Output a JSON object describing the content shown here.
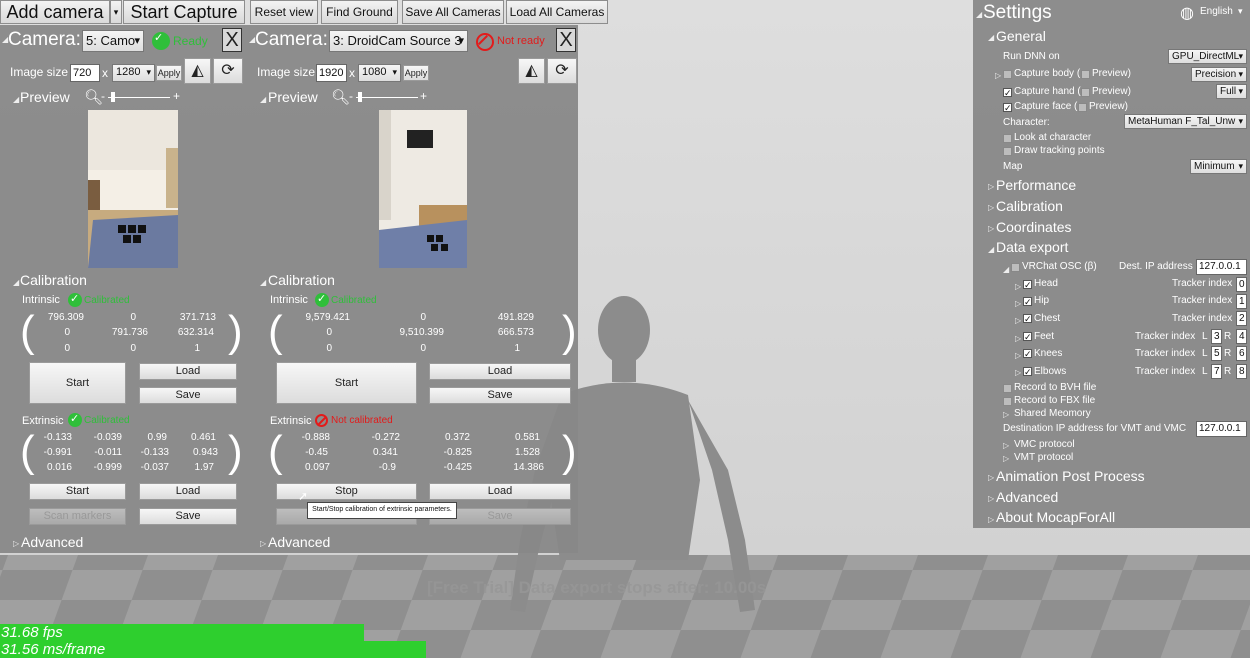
{
  "toolbar": {
    "add_camera": "Add camera",
    "start_capture": "Start Capture",
    "reset_view": "Reset view",
    "find_ground": "Find Ground",
    "save_all": "Save All Cameras",
    "load_all": "Load All Cameras"
  },
  "cameras": [
    {
      "label": "Camera:",
      "source": "5: Camo",
      "status": "Ready",
      "close": "X",
      "image_size_label": "Image size",
      "width": "720",
      "x": "x",
      "height": "1280",
      "apply": "Apply",
      "preview_label": "Preview",
      "calibration_label": "Calibration",
      "intrinsic_label": "Intrinsic",
      "intrinsic_status": "Calibrated",
      "intrinsic": [
        [
          "796.309",
          "0",
          "371.713"
        ],
        [
          "0",
          "791.736",
          "632.314"
        ],
        [
          "0",
          "0",
          "1"
        ]
      ],
      "start": "Start",
      "load": "Load",
      "save": "Save",
      "extrinsic_label": "Extrinsic",
      "extrinsic_status": "Calibrated",
      "extrinsic": [
        [
          "-0.133",
          "-0.039",
          "0.99",
          "0.461"
        ],
        [
          "-0.991",
          "-0.011",
          "-0.133",
          "0.943"
        ],
        [
          "0.016",
          "-0.999",
          "-0.037",
          "1.97"
        ]
      ],
      "ext_start": "Start",
      "ext_load": "Load",
      "scan_markers": "Scan markers",
      "ext_save": "Save",
      "advanced": "Advanced"
    },
    {
      "label": "Camera:",
      "source": "3: DroidCam Source 3",
      "status": "Not ready",
      "close": "X",
      "image_size_label": "Image size",
      "width": "1920",
      "x": "x",
      "height": "1080",
      "apply": "Apply",
      "preview_label": "Preview",
      "calibration_label": "Calibration",
      "intrinsic_label": "Intrinsic",
      "intrinsic_status": "Calibrated",
      "intrinsic": [
        [
          "9,579.421",
          "0",
          "491.829"
        ],
        [
          "0",
          "9,510.399",
          "666.573"
        ],
        [
          "0",
          "0",
          "1"
        ]
      ],
      "start": "Start",
      "load": "Load",
      "save": "Save",
      "extrinsic_label": "Extrinsic",
      "extrinsic_status": "Not calibrated",
      "extrinsic": [
        [
          "-0.888",
          "-0.272",
          "0.372",
          "0.581"
        ],
        [
          "-0.45",
          "0.341",
          "-0.825",
          "1.528"
        ],
        [
          "0.097",
          "-0.9",
          "-0.425",
          "14.386"
        ]
      ],
      "ext_stop": "Stop",
      "ext_load": "Load",
      "ext_save": "Save",
      "tooltip": "Start/Stop calibration of extrinsic parameters.",
      "advanced": "Advanced"
    }
  ],
  "settings": {
    "title": "Settings",
    "language": "English",
    "general": "General",
    "run_dnn_label": "Run DNN on",
    "run_dnn_value": "GPU_DirectML",
    "capture_body": "Capture body (",
    "capture_body_preview": "Preview)",
    "capture_body_mode": "Precision",
    "capture_hand": "Capture hand (",
    "capture_hand_preview": "Preview)",
    "capture_hand_mode": "Full",
    "capture_face": "Capture face (",
    "capture_face_preview": "Preview)",
    "character_label": "Character:",
    "character_value": "MetaHuman F_Tal_Unw",
    "look_at": "Look at character",
    "draw_tracking": "Draw tracking points",
    "map_label": "Map",
    "map_value": "Minimum",
    "performance": "Performance",
    "calibration": "Calibration",
    "coordinates": "Coordinates",
    "data_export": "Data export",
    "vrchat": "VRChat OSC (β)",
    "dest_ip_label": "Dest. IP address",
    "dest_ip": "127.0.0.1",
    "trackers": [
      {
        "name": "Head",
        "label": "Tracker index",
        "values": [
          "0"
        ]
      },
      {
        "name": "Hip",
        "label": "Tracker index",
        "values": [
          "1"
        ]
      },
      {
        "name": "Chest",
        "label": "Tracker index",
        "values": [
          "2"
        ]
      },
      {
        "name": "Feet",
        "label": "Tracker index",
        "l": "L",
        "r": "R",
        "values": [
          "3",
          "4"
        ]
      },
      {
        "name": "Knees",
        "label": "Tracker index",
        "l": "L",
        "r": "R",
        "values": [
          "5",
          "6"
        ]
      },
      {
        "name": "Elbows",
        "label": "Tracker index",
        "l": "L",
        "r": "R",
        "values": [
          "7",
          "8"
        ]
      }
    ],
    "record_bvh": "Record to BVH file",
    "record_fbx": "Record to FBX file",
    "shared_memory": "Shared Meomory",
    "vmt_dest_label": "Destination IP address for VMT and VMC",
    "vmt_dest_ip": "127.0.0.1",
    "vmc_protocol": "VMC protocol",
    "vmt_protocol": "VMT protocol",
    "anim_post": "Animation Post Process",
    "advanced": "Advanced",
    "about": "About MocapForAll"
  },
  "overlay": {
    "trial_notice": "[Free Trial] Data export stops after: 10.00s"
  },
  "stats": {
    "fps": "31.68 fps",
    "ms": "31.56 ms/frame"
  },
  "colors": {
    "ready": "#2fbf3a",
    "not_ready": "#e21b1b",
    "fps_bar": "#2ecf2e",
    "panel": "#888888"
  }
}
